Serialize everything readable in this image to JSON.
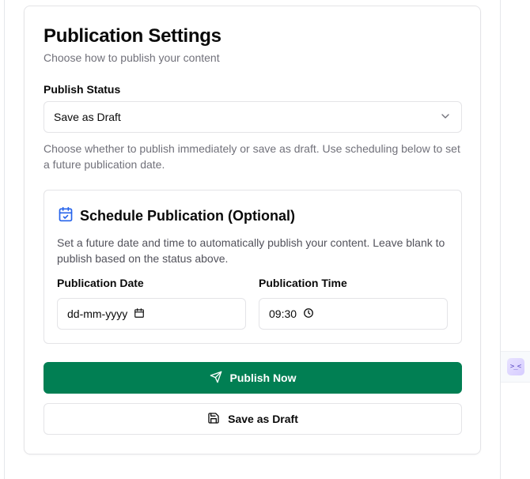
{
  "card": {
    "title": "Publication Settings",
    "subtitle": "Choose how to publish your content"
  },
  "publish_status": {
    "label": "Publish Status",
    "selected": "Save as Draft",
    "help": "Choose whether to publish immediately or save as draft. Use scheduling below to set a future publication date."
  },
  "schedule": {
    "title": "Schedule Publication (Optional)",
    "description": "Set a future date and time to automatically publish your content. Leave blank to publish based on the status above.",
    "date_label": "Publication Date",
    "date_value": "dd-mm-yyyy",
    "time_label": "Publication Time",
    "time_value": "09:30"
  },
  "actions": {
    "publish_label": "Publish Now",
    "draft_label": "Save as Draft"
  },
  "side_widget": {
    "glyph": ">_<"
  },
  "colors": {
    "primary": "#017f53",
    "icon_accent": "#2563eb",
    "muted_text": "#71717a",
    "border": "#e4e4e7"
  }
}
